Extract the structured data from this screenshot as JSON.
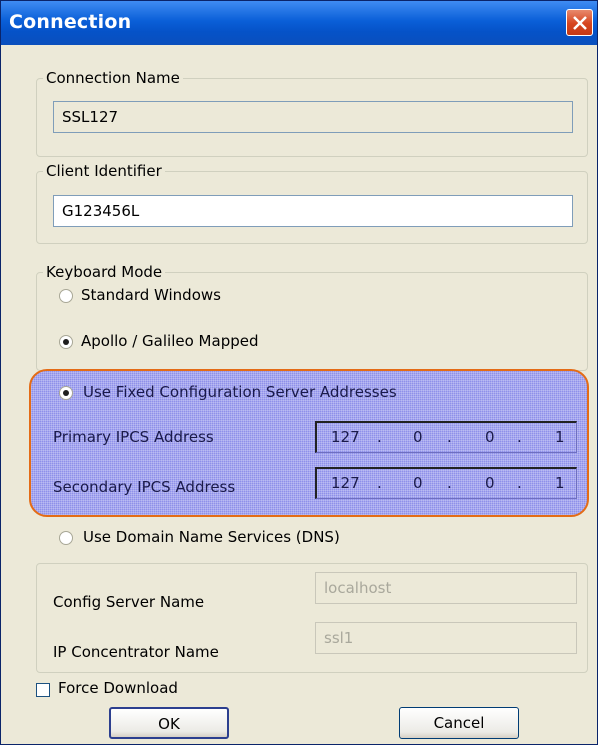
{
  "window": {
    "title": "Connection"
  },
  "connection_name": {
    "legend": "Connection Name",
    "value": "SSL127"
  },
  "client_identifier": {
    "legend": "Client Identifier",
    "value": "G123456L"
  },
  "keyboard_mode": {
    "legend": "Keyboard Mode",
    "options": [
      {
        "label": "Standard Windows",
        "selected": false
      },
      {
        "label": "Apollo / Galileo Mapped",
        "selected": true
      }
    ]
  },
  "fixed_config": {
    "label": "Use Fixed Configuration Server Addresses",
    "selected": true,
    "primary_label": "Primary IPCS Address",
    "primary_ip": [
      "127",
      "0",
      "0",
      "1"
    ],
    "secondary_label": "Secondary IPCS Address",
    "secondary_ip": [
      "127",
      "0",
      "0",
      "1"
    ]
  },
  "dns": {
    "label": "Use Domain Name Services (DNS)",
    "selected": false,
    "config_server_label": "Config Server Name",
    "config_server_value": "localhost",
    "ip_concentrator_label": "IP Concentrator  Name",
    "ip_concentrator_value": "ssl1"
  },
  "force_download": {
    "label": "Force Download",
    "checked": false
  },
  "buttons": {
    "ok": "OK",
    "cancel": "Cancel"
  },
  "colors": {
    "titlebar": "#0552c8",
    "highlight_border": "#e46c16",
    "highlight_fill": "#8e90ea",
    "dialog_bg": "#ece9d8"
  }
}
